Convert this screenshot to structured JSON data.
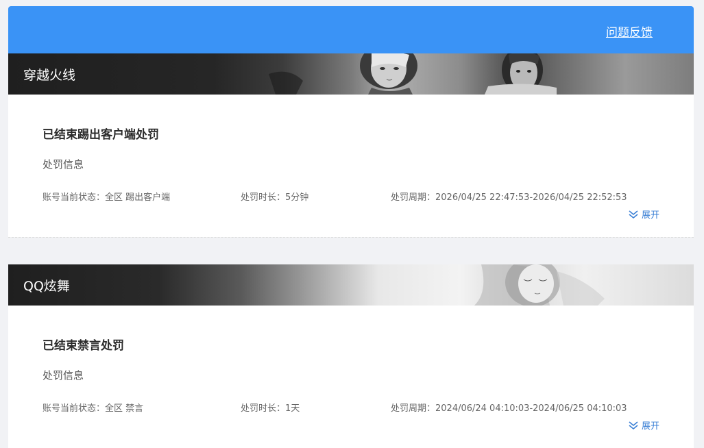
{
  "header": {
    "feedback_label": "问题反馈",
    "accent_color": "#3a93f6"
  },
  "penalties": [
    {
      "game": "穿越火线",
      "status_title": "已结束踢出客户端处罚",
      "info_label": "处罚信息",
      "account_status": "账号当前状态：全区 踢出客户端",
      "duration": "处罚时长：5分钟",
      "period": "处罚周期：2026/04/25 22:47:53-2026/04/25 22:52:53",
      "expand_label": "展开"
    },
    {
      "game": "QQ炫舞",
      "status_title": "已结束禁言处罚",
      "info_label": "处罚信息",
      "account_status": "账号当前状态：全区 禁言",
      "duration": "处罚时长：1天",
      "period": "处罚周期：2024/06/24 04:10:03-2024/06/25 04:10:03",
      "expand_label": "展开"
    }
  ]
}
